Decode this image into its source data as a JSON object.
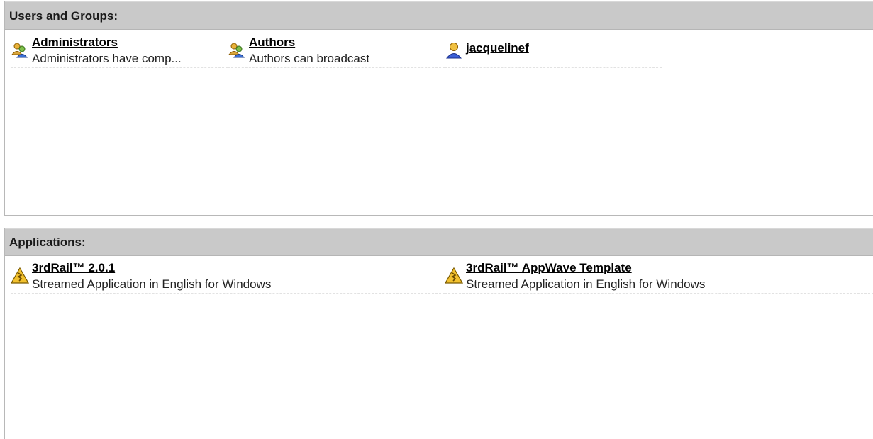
{
  "users_panel": {
    "title": "Users and Groups:",
    "items": [
      {
        "name": "Administrators",
        "description": "Administrators have comp...",
        "icon": "group-icon"
      },
      {
        "name": "Authors",
        "description": "Authors can broadcast",
        "icon": "group-icon"
      },
      {
        "name": "jacquelinef",
        "description": "",
        "icon": "user-icon"
      }
    ]
  },
  "apps_panel": {
    "title": "Applications:",
    "items": [
      {
        "name": "3rdRail™ 2.0.1",
        "description": "Streamed Application in English for Windows",
        "icon": "warning-icon"
      },
      {
        "name": "3rdRail™ AppWave Template",
        "description": "Streamed Application in English for Windows",
        "icon": "warning-icon"
      }
    ]
  },
  "colors": {
    "header_bg": "#c9c9c9",
    "link": "#000000",
    "warning": "#f2c12e"
  }
}
